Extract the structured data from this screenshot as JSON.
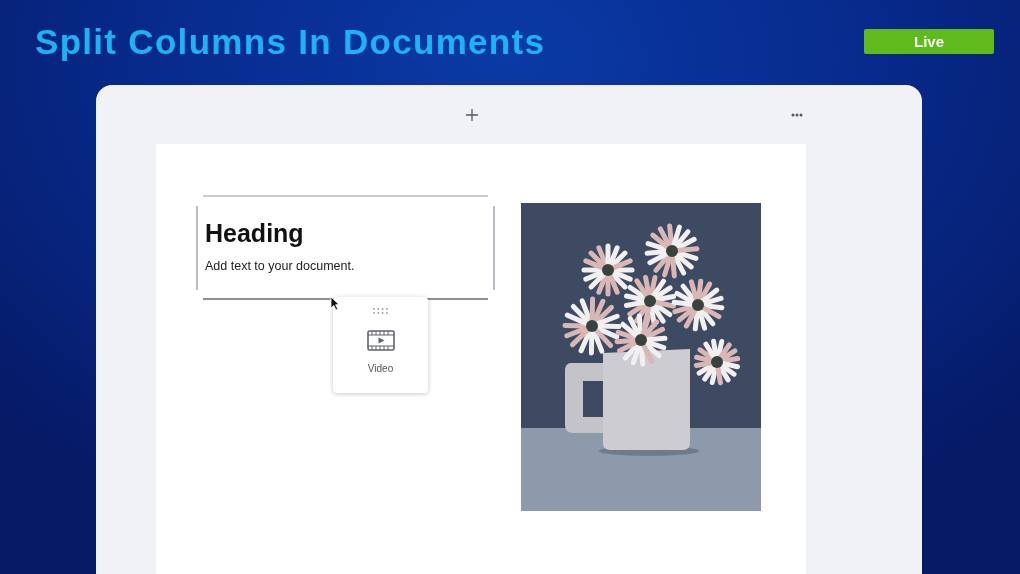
{
  "header": {
    "title": "Split Columns In Documents",
    "badge": "Live"
  },
  "document": {
    "columns": [
      {
        "kind": "text",
        "heading": "Heading",
        "body": "Add text to your document.",
        "selected": true
      },
      {
        "kind": "image"
      }
    ]
  },
  "drag_card": {
    "label": "Video"
  }
}
